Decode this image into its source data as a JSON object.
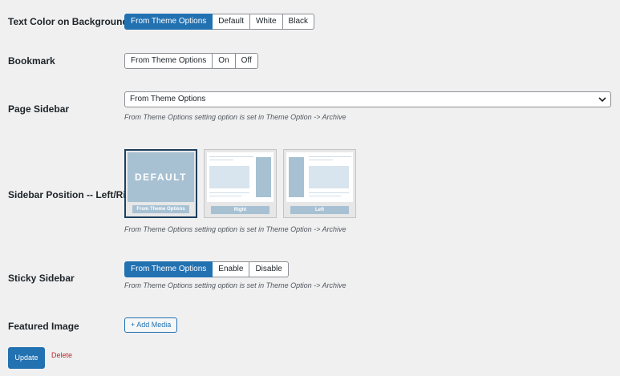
{
  "rows": {
    "text_color": {
      "label": "Text Color on Background Color",
      "options": [
        "From Theme Options",
        "Default",
        "White",
        "Black"
      ],
      "selected": "From Theme Options"
    },
    "bookmark": {
      "label": "Bookmark",
      "options": [
        "From Theme Options",
        "On",
        "Off"
      ],
      "selected": ""
    },
    "page_sidebar": {
      "label": "Page Sidebar",
      "value": "From Theme Options",
      "help": "From Theme Options setting option is set in Theme Option -> Archive"
    },
    "sidebar_position": {
      "label": "Sidebar Position -- Left/Right",
      "default_text": "DEFAULT",
      "options": [
        "From Theme Options",
        "Right",
        "Left"
      ],
      "selected": "From Theme Options",
      "help": "From Theme Options setting option is set in Theme Option -> Archive"
    },
    "sticky_sidebar": {
      "label": "Sticky Sidebar",
      "options": [
        "From Theme Options",
        "Enable",
        "Disable"
      ],
      "selected": "From Theme Options",
      "help": "From Theme Options setting option is set in Theme Option -> Archive"
    },
    "featured_image": {
      "label": "Featured Image",
      "button": "+ Add Media"
    }
  },
  "actions": {
    "update": "Update",
    "delete": "Delete"
  },
  "colors": {
    "accent": "#2271b1",
    "delete": "#b32d2e",
    "background": "#f0f0f1",
    "selected_card_border": "#1d3f5e",
    "layout_fill": "#a7c1d3"
  },
  "icons": {
    "select_arrow": "chevron-down-icon"
  }
}
